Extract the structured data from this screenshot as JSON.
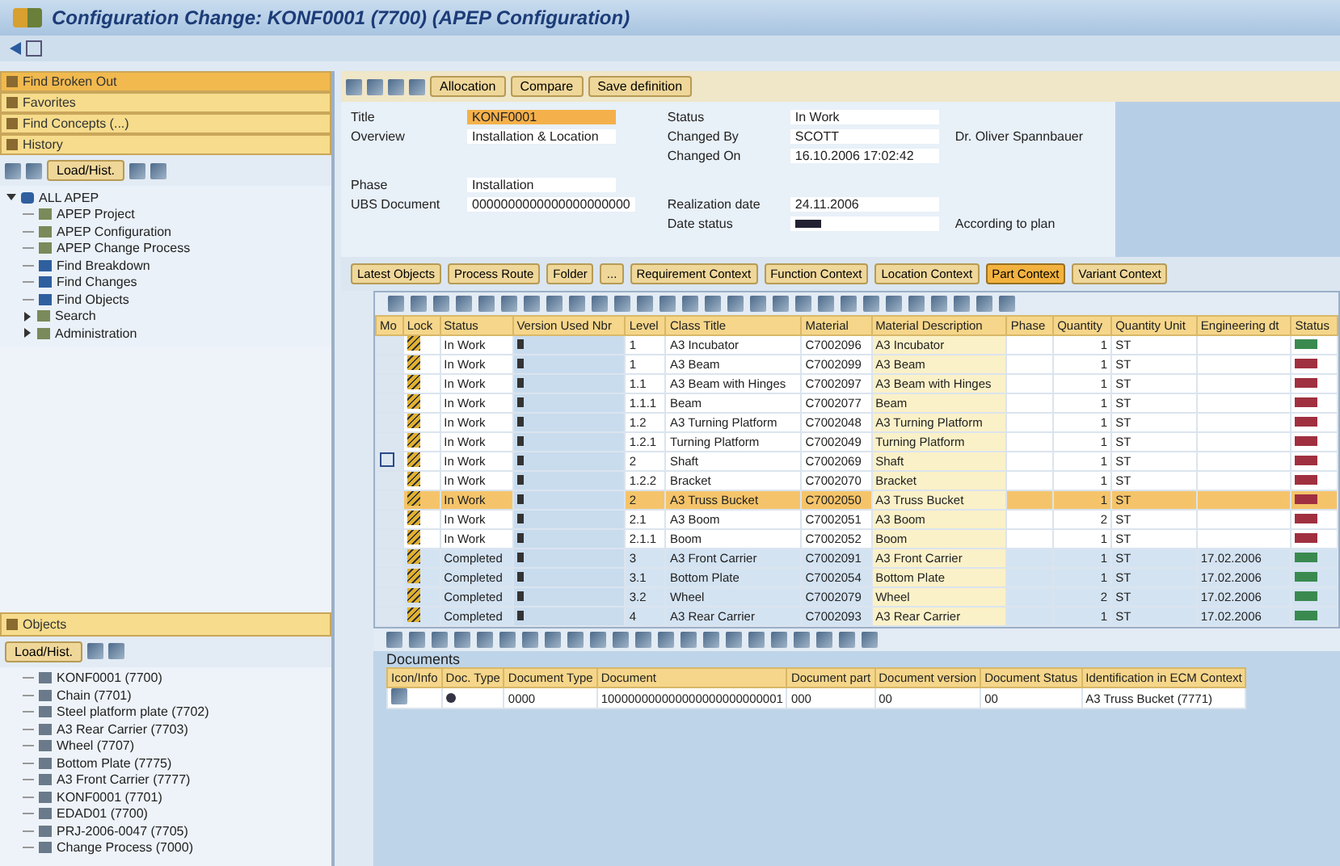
{
  "window": {
    "title": "Configuration Change: KONF0001 (7700) (APEP Configuration)"
  },
  "sidebar": {
    "sections": [
      {
        "label": "Find Broken Out"
      },
      {
        "label": "Favorites"
      },
      {
        "label": "Find Concepts (...)"
      },
      {
        "label": "History"
      }
    ],
    "tree_button": "Load/Hist.",
    "tree": {
      "label": "ALL APEP",
      "expanded": true,
      "children": [
        {
          "label": "APEP Project"
        },
        {
          "label": "APEP Configuration"
        },
        {
          "label": "APEP Change Process"
        },
        {
          "label": "Find Breakdown"
        },
        {
          "label": "Find Changes"
        },
        {
          "label": "Find Objects"
        },
        {
          "label": "Search",
          "expanded": false
        },
        {
          "label": "Administration",
          "expanded": false
        }
      ]
    },
    "objects_header": "Objects",
    "objects_button": "Load/Hist.",
    "objects": [
      "KONF0001 (7700)",
      "Chain (7701)",
      "Steel platform plate (7702)",
      "A3 Rear Carrier (7703)",
      "Wheel (7707)",
      "Bottom Plate (7775)",
      "A3 Front Carrier (7777)",
      "KONF0001 (7701)",
      "EDAD01 (7700)",
      "PRJ-2006-0047 (7705)",
      "Change Process (7000)"
    ]
  },
  "toolbar": {
    "buttons": [
      "Allocation",
      "Compare",
      "Save definition"
    ]
  },
  "header_fields": {
    "left": [
      {
        "label": "Title",
        "value": "KONF0001",
        "highlight": true
      },
      {
        "label": "Overview",
        "value": "Installation & Location",
        "highlight": false
      },
      {
        "label": "Phase",
        "value": "Installation",
        "highlight": false
      },
      {
        "label": "UBS Document",
        "value": "0000000000000000000000",
        "highlight": false
      }
    ],
    "right": [
      {
        "label": "Status",
        "value": "In Work"
      },
      {
        "label": "Changed By",
        "value": "SCOTT",
        "note": "Dr. Oliver Spannbauer"
      },
      {
        "label": "Changed On",
        "value": "16.10.2006 17:02:42"
      },
      {
        "label": "Realization date",
        "value": "24.11.2006"
      },
      {
        "label": "Date status",
        "note": "According to plan"
      }
    ]
  },
  "context_buttons": [
    {
      "label": "Latest Objects",
      "selected": false
    },
    {
      "label": "Process Route",
      "selected": false
    },
    {
      "label": "Folder",
      "selected": false
    },
    {
      "label": "...",
      "selected": false
    },
    {
      "label": "Requirement Context",
      "selected": false
    },
    {
      "label": "Function Context",
      "selected": false
    },
    {
      "label": "Location Context",
      "selected": false
    },
    {
      "label": "Part Context",
      "selected": true
    },
    {
      "label": "Variant Context",
      "selected": false
    }
  ],
  "table": {
    "columns": [
      "Mo",
      "Lock",
      "Status",
      "Version Used Nbr",
      "Level",
      "Class Title",
      "Material",
      "Material Description",
      "Phase",
      "Quantity",
      "Quantity Unit",
      "Engineering dt",
      "Status"
    ],
    "rows": [
      {
        "status": "In Work",
        "level": "1",
        "title": "A3 Incubator",
        "material": "C7002096",
        "description": "A3 Incubator",
        "quantity": "1",
        "unit": "ST",
        "eng_date": "",
        "color": "#3a8a50",
        "selected": false,
        "marked": false
      },
      {
        "status": "In Work",
        "level": "1",
        "title": "A3 Beam",
        "material": "C7002099",
        "description": "A3 Beam",
        "quantity": "1",
        "unit": "ST",
        "eng_date": "",
        "color": "#a03040",
        "selected": false,
        "marked": false
      },
      {
        "status": "In Work",
        "level": "1.1",
        "title": "A3 Beam with Hinges",
        "material": "C7002097",
        "description": "A3 Beam with Hinges",
        "quantity": "1",
        "unit": "ST",
        "eng_date": "",
        "color": "#a03040",
        "selected": false,
        "marked": false
      },
      {
        "status": "In Work",
        "level": "1.1.1",
        "title": "Beam",
        "material": "C7002077",
        "description": "Beam",
        "quantity": "1",
        "unit": "ST",
        "eng_date": "",
        "color": "#a03040",
        "selected": false,
        "marked": false
      },
      {
        "status": "In Work",
        "level": "1.2",
        "title": "A3 Turning Platform",
        "material": "C7002048",
        "description": "A3 Turning Platform",
        "quantity": "1",
        "unit": "ST",
        "eng_date": "",
        "color": "#a03040",
        "selected": false,
        "marked": false
      },
      {
        "status": "In Work",
        "level": "1.2.1",
        "title": "Turning Platform",
        "material": "C7002049",
        "description": "Turning Platform",
        "quantity": "1",
        "unit": "ST",
        "eng_date": "",
        "color": "#a03040",
        "selected": false,
        "marked": false
      },
      {
        "status": "In Work",
        "level": "2",
        "title": "Shaft",
        "material": "C7002069",
        "description": "Shaft",
        "quantity": "1",
        "unit": "ST",
        "eng_date": "",
        "color": "#a03040",
        "selected": false,
        "marked": true
      },
      {
        "status": "In Work",
        "level": "1.2.2",
        "title": "Bracket",
        "material": "C7002070",
        "description": "Bracket",
        "quantity": "1",
        "unit": "ST",
        "eng_date": "",
        "color": "#a03040",
        "selected": false,
        "marked": false
      },
      {
        "status": "In Work",
        "level": "2",
        "title": "A3 Truss Bucket",
        "material": "C7002050",
        "description": "A3 Truss Bucket",
        "quantity": "1",
        "unit": "ST",
        "eng_date": "",
        "color": "#a03040",
        "selected": true,
        "marked": false
      },
      {
        "status": "In Work",
        "level": "2.1",
        "title": "A3 Boom",
        "material": "C7002051",
        "description": "A3 Boom",
        "quantity": "2",
        "unit": "ST",
        "eng_date": "",
        "color": "#a03040",
        "selected": false,
        "marked": false
      },
      {
        "status": "In Work",
        "level": "2.1.1",
        "title": "Boom",
        "material": "C7002052",
        "description": "Boom",
        "quantity": "1",
        "unit": "ST",
        "eng_date": "",
        "color": "#a03040",
        "selected": false,
        "marked": false
      },
      {
        "status": "Completed",
        "level": "3",
        "title": "A3 Front Carrier",
        "material": "C7002091",
        "description": "A3 Front Carrier",
        "quantity": "1",
        "unit": "ST",
        "eng_date": "17.02.2006",
        "color": "#3a8a50",
        "selected": false,
        "marked": false
      },
      {
        "status": "Completed",
        "level": "3.1",
        "title": "Bottom Plate",
        "material": "C7002054",
        "description": "Bottom Plate",
        "quantity": "1",
        "unit": "ST",
        "eng_date": "17.02.2006",
        "color": "#3a8a50",
        "selected": false,
        "marked": false
      },
      {
        "status": "Completed",
        "level": "3.2",
        "title": "Wheel",
        "material": "C7002079",
        "description": "Wheel",
        "quantity": "2",
        "unit": "ST",
        "eng_date": "17.02.2006",
        "color": "#3a8a50",
        "selected": false,
        "marked": false
      },
      {
        "status": "Completed",
        "level": "4",
        "title": "A3 Rear Carrier",
        "material": "C7002093",
        "description": "A3 Rear Carrier",
        "quantity": "1",
        "unit": "ST",
        "eng_date": "17.02.2006",
        "color": "#3a8a50",
        "selected": false,
        "marked": false
      }
    ]
  },
  "documents": {
    "title": "Documents",
    "columns": [
      "Icon/Info",
      "Doc. Type",
      "Document Type",
      "Document",
      "Document part",
      "Document version",
      "Document Status",
      "Identification in ECM Context"
    ],
    "rows": [
      {
        "doc_type": "0000",
        "document": "100000000000000000000000001",
        "part": "000",
        "version": "00",
        "status": "00",
        "ecm": "A3 Truss Bucket (7771)"
      }
    ]
  }
}
